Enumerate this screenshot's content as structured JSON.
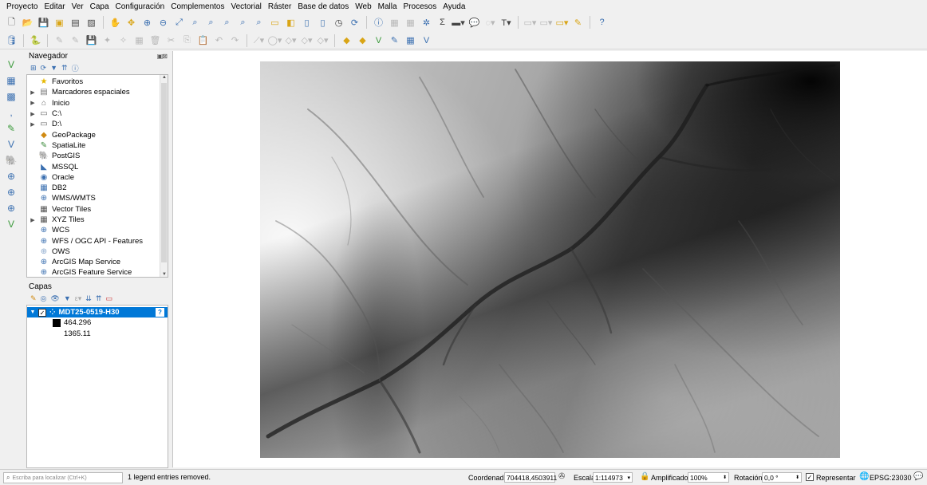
{
  "menu": [
    "Proyecto",
    "Editar",
    "Ver",
    "Capa",
    "Configuración",
    "Complementos",
    "Vectorial",
    "Ráster",
    "Base de datos",
    "Web",
    "Malla",
    "Procesos",
    "Ayuda"
  ],
  "navigator": {
    "title": "Navegador",
    "items": [
      {
        "label": "Favoritos",
        "expandable": false,
        "icon": "star-icon",
        "glyph": "★",
        "color": "#e6b800"
      },
      {
        "label": "Marcadores espaciales",
        "expandable": true,
        "icon": "bookmark-icon",
        "glyph": "▤",
        "color": "#777777"
      },
      {
        "label": "Inicio",
        "expandable": true,
        "icon": "home-folder-icon",
        "glyph": "⌂",
        "color": "#666666"
      },
      {
        "label": "C:\\",
        "expandable": true,
        "icon": "drive-icon",
        "glyph": "▭",
        "color": "#666666"
      },
      {
        "label": "D:\\",
        "expandable": true,
        "icon": "drive-icon",
        "glyph": "▭",
        "color": "#666666"
      },
      {
        "label": "GeoPackage",
        "expandable": false,
        "icon": "geopackage-icon",
        "glyph": "◆",
        "color": "#d08a12"
      },
      {
        "label": "SpatiaLite",
        "expandable": false,
        "icon": "spatialite-icon",
        "glyph": "✎",
        "color": "#3a8a3a"
      },
      {
        "label": "PostGIS",
        "expandable": false,
        "icon": "postgis-icon",
        "glyph": "🐘",
        "color": "#336699"
      },
      {
        "label": "MSSQL",
        "expandable": false,
        "icon": "mssql-icon",
        "glyph": "◣",
        "color": "#3a6fb0"
      },
      {
        "label": "Oracle",
        "expandable": false,
        "icon": "oracle-icon",
        "glyph": "◉",
        "color": "#3a6fb0"
      },
      {
        "label": "DB2",
        "expandable": false,
        "icon": "db2-icon",
        "glyph": "▦",
        "color": "#3a6fb0"
      },
      {
        "label": "WMS/WMTS",
        "expandable": false,
        "icon": "wms-icon",
        "glyph": "⊕",
        "color": "#3a6fb0"
      },
      {
        "label": "Vector Tiles",
        "expandable": false,
        "icon": "vector-tiles-icon",
        "glyph": "▦",
        "color": "#555555"
      },
      {
        "label": "XYZ Tiles",
        "expandable": true,
        "icon": "xyz-tiles-icon",
        "glyph": "▦",
        "color": "#555555"
      },
      {
        "label": "WCS",
        "expandable": false,
        "icon": "wcs-icon",
        "glyph": "⊕",
        "color": "#3a6fb0"
      },
      {
        "label": "WFS / OGC API - Features",
        "expandable": false,
        "icon": "wfs-icon",
        "glyph": "⊕",
        "color": "#3a6fb0"
      },
      {
        "label": "OWS",
        "expandable": false,
        "icon": "ows-icon",
        "glyph": "⊕",
        "color": "#8aa8cc"
      },
      {
        "label": "ArcGIS Map Service",
        "expandable": false,
        "icon": "arcgis-map-icon",
        "glyph": "⊕",
        "color": "#3a6fb0"
      },
      {
        "label": "ArcGIS Feature Service",
        "expandable": false,
        "icon": "arcgis-feature-icon",
        "glyph": "⊕",
        "color": "#3a6fb0"
      }
    ]
  },
  "layers": {
    "title": "Capas",
    "layer": {
      "name": "MDT25-0519-H30",
      "checked": true
    },
    "legend_min": "464.296",
    "legend_max": "1365.11"
  },
  "status": {
    "locator_placeholder": "Escriba para localizar (Ctrl+K)",
    "message": "1 legend entries removed.",
    "coord_label": "Coordenada",
    "coord_value": "704418,4503911",
    "scale_label": "Escala",
    "scale_value": "1:114973",
    "magnifier_label": "Amplificador",
    "magnifier_value": "100%",
    "rotation_label": "Rotación",
    "rotation_value": "0,0 °",
    "render_label": "Representar",
    "crs": "EPSG:23030"
  },
  "colors": {
    "selection": "#0078d7",
    "accent": "#3a6fb0"
  }
}
